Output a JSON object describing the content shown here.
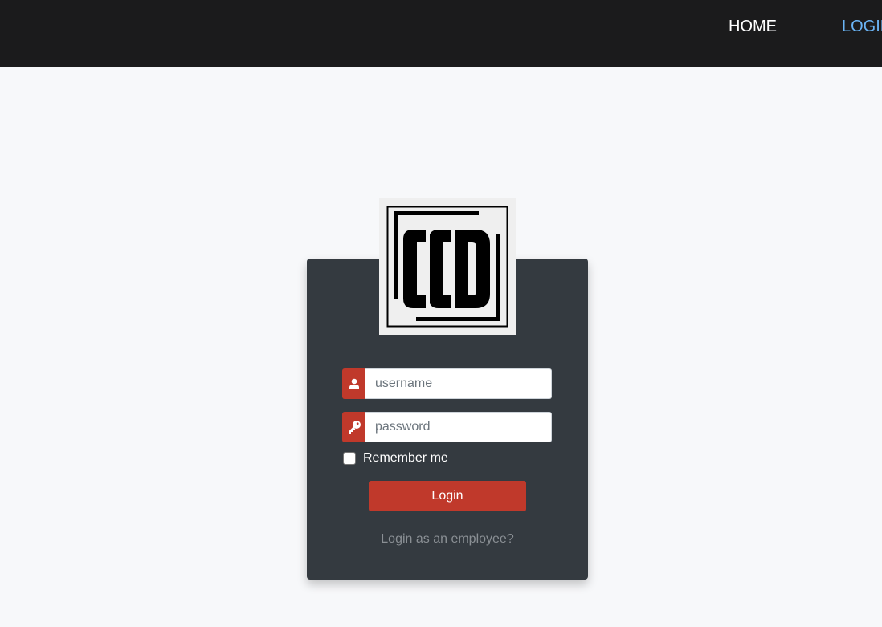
{
  "nav": {
    "home_label": "HOME",
    "login_label": "LOGIN"
  },
  "logo": {
    "text": "CCD"
  },
  "form": {
    "username_placeholder": "username",
    "password_placeholder": "password",
    "remember_label": "Remember me",
    "remember_checked": false,
    "login_button": "Login",
    "employee_link": "Login as an employee?"
  },
  "colors": {
    "navbar_bg": "#1b1b1c",
    "card_bg": "#343a40",
    "accent": "#c0392b",
    "active_link": "#6ab4f5"
  },
  "icons": {
    "username": "user-icon",
    "password": "key-icon"
  }
}
